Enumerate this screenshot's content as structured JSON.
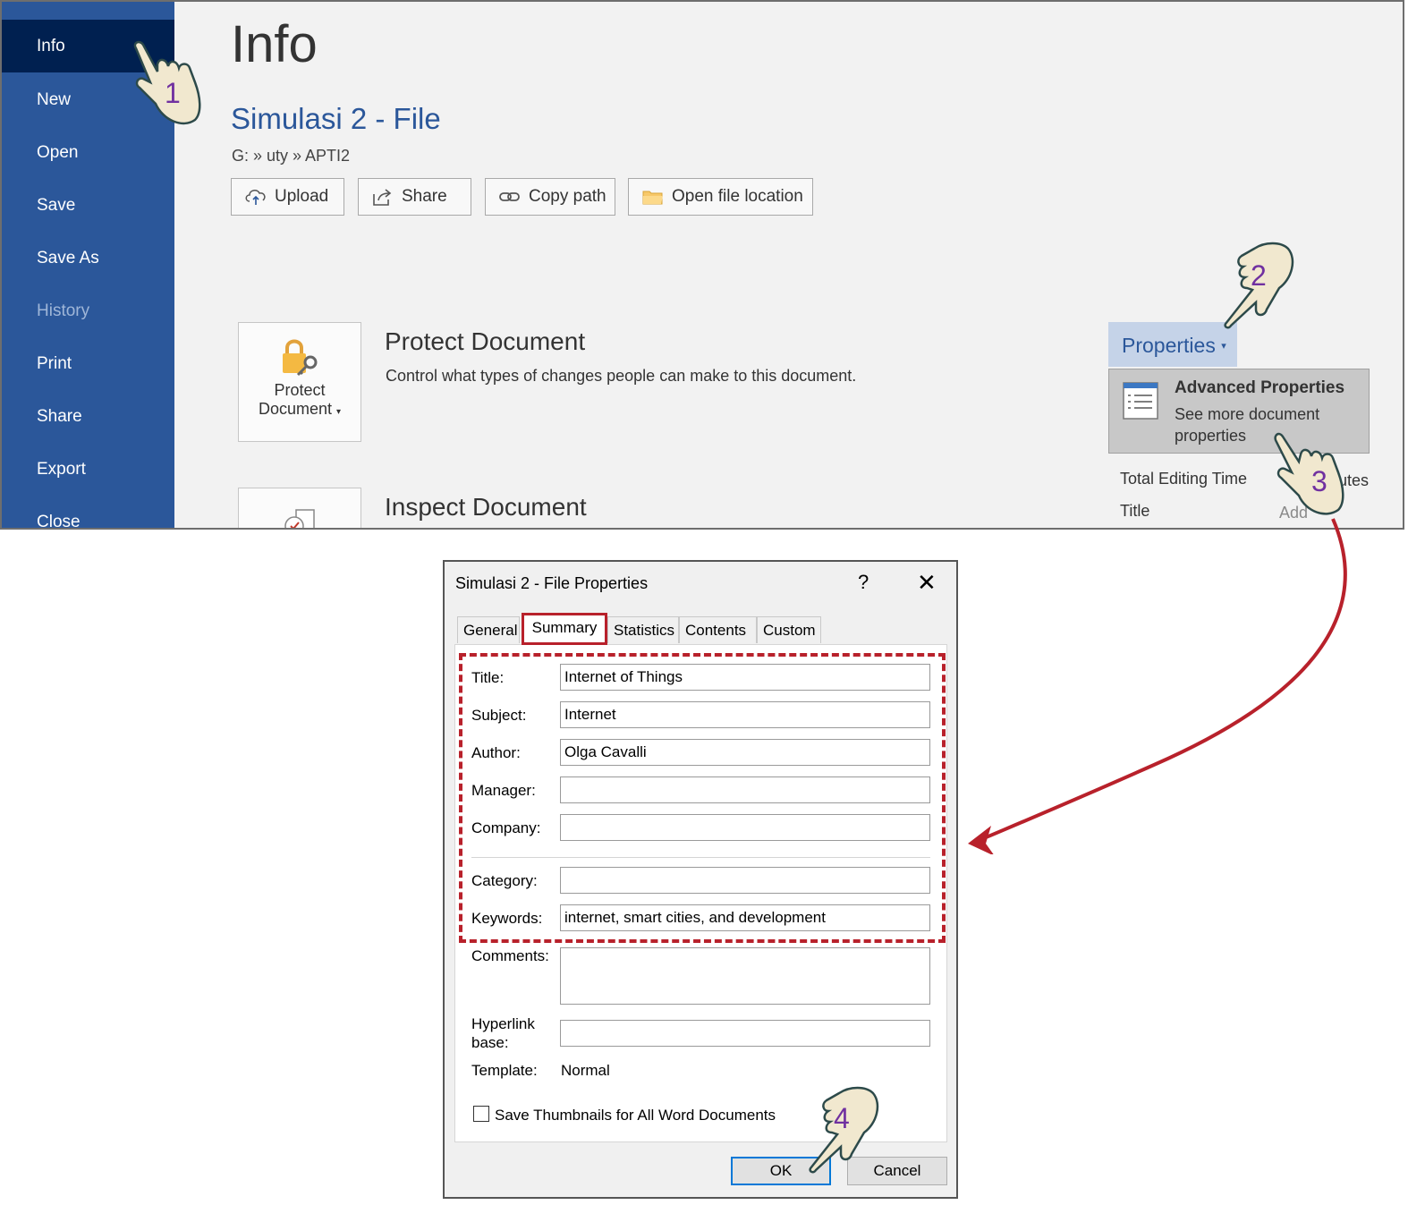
{
  "sidebar": {
    "items": [
      {
        "label": "Info"
      },
      {
        "label": "New"
      },
      {
        "label": "Open"
      },
      {
        "label": "Save"
      },
      {
        "label": "Save As"
      },
      {
        "label": "History"
      },
      {
        "label": "Print"
      },
      {
        "label": "Share"
      },
      {
        "label": "Export"
      },
      {
        "label": "Close"
      }
    ]
  },
  "main": {
    "title": "Info",
    "doc_name": "Simulasi 2 - File",
    "path": "G: » uty » APTI2",
    "buttons": {
      "upload": "Upload",
      "share": "Share",
      "copy_path": "Copy path",
      "open_location": "Open file location"
    },
    "protect": {
      "button_line1": "Protect",
      "button_line2": "Document",
      "title": "Protect Document",
      "description": "Control what types of changes people can make to this document."
    },
    "inspect": {
      "title": "Inspect Document"
    },
    "properties": {
      "button_label": "Properties",
      "menu_title": "Advanced Properties",
      "menu_desc": "See more document properties",
      "rows": [
        {
          "label": "Total Editing Time",
          "value": "utes"
        },
        {
          "label": "Title",
          "value": "Add"
        }
      ]
    }
  },
  "dialog": {
    "title": "Simulasi 2 - File Properties",
    "help": "?",
    "close": "✕",
    "tabs": [
      "General",
      "Summary",
      "Statistics",
      "Contents",
      "Custom"
    ],
    "fields": {
      "title": {
        "label": "Title:",
        "value": "Internet of Things"
      },
      "subject": {
        "label": "Subject:",
        "value": "Internet"
      },
      "author": {
        "label": "Author:",
        "value": "Olga Cavalli"
      },
      "manager": {
        "label": "Manager:",
        "value": ""
      },
      "company": {
        "label": "Company:",
        "value": ""
      },
      "category": {
        "label": "Category:",
        "value": ""
      },
      "keywords": {
        "label": "Keywords:",
        "value": "internet, smart cities, and development"
      },
      "comments": {
        "label": "Comments:",
        "value": ""
      },
      "hyperlink_line1": "Hyperlink",
      "hyperlink_line2": "base:",
      "hyperlink_value": "",
      "template": {
        "label": "Template:",
        "value": "Normal"
      }
    },
    "thumbnails_label": "Save Thumbnails for All Word Documents",
    "ok": "OK",
    "cancel": "Cancel"
  },
  "steps": [
    "1",
    "2",
    "3",
    "4"
  ],
  "colors": {
    "sidebar": "#2b579a",
    "sidebar_active": "#002050",
    "accent": "#2b579a",
    "highlight": "#b8212b",
    "step_number": "#7030a0"
  },
  "icons": [
    "hand-pointer-icon",
    "cloud-upload-icon",
    "share-icon",
    "link-icon",
    "folder-icon",
    "lock-icon",
    "properties-list-icon",
    "inspect-icon"
  ]
}
